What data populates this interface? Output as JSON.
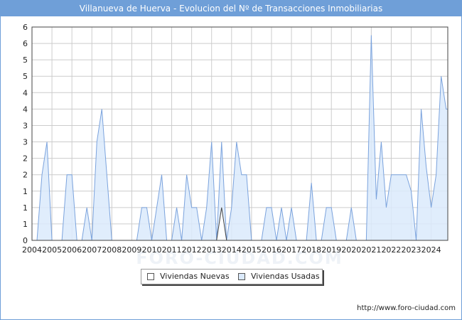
{
  "page": {
    "title": "Villanueva de Huerva - Evolucion del Nº de Transacciones Inmobiliarias",
    "footer_url": "http://www.foro-ciudad.com",
    "watermark": "FORO-CIUDAD.COM"
  },
  "colors": {
    "title_bg": "#6f9fd8",
    "usadas_fill": "#dbeafc",
    "usadas_line": "#7ba3dd",
    "nuevas_fill": "#ffffff",
    "nuevas_line": "#444444",
    "grid": "#cccccc"
  },
  "chart_data": {
    "type": "area",
    "xlim": [
      2004.0,
      2024.833
    ],
    "ylim": [
      0,
      6.5
    ],
    "y_ticks": [
      0,
      0.5,
      1,
      1.5,
      2,
      2.5,
      3,
      3.5,
      4,
      4.5,
      5,
      5.5,
      6,
      6.5
    ],
    "y_tick_labels": [
      "0",
      "1",
      "1",
      "1",
      "2",
      "2",
      "3",
      "3",
      "4",
      "4",
      "5",
      "5",
      "6",
      "6"
    ],
    "x_ticks": [
      2004,
      2005,
      2006,
      2007,
      2008,
      2009,
      2010,
      2011,
      2012,
      2013,
      2014,
      2015,
      2016,
      2017,
      2018,
      2019,
      2020,
      2021,
      2022,
      2023,
      2024
    ],
    "grid": true,
    "legend_position": "bottom-center",
    "series": [
      {
        "name": "Viviendas Nuevas",
        "x": [
          2004.0,
          2013.25,
          2013.5,
          2013.75,
          2024.833
        ],
        "y": [
          0,
          0,
          1,
          0,
          0
        ]
      },
      {
        "name": "Viviendas Usadas",
        "x": [
          2004.0,
          2004.25,
          2004.5,
          2004.75,
          2005.0,
          2005.25,
          2005.5,
          2005.75,
          2006.0,
          2006.25,
          2006.5,
          2006.75,
          2007.0,
          2007.25,
          2007.5,
          2007.75,
          2008.0,
          2008.25,
          2008.5,
          2008.75,
          2009.0,
          2009.25,
          2009.5,
          2009.75,
          2010.0,
          2010.25,
          2010.5,
          2010.75,
          2011.0,
          2011.25,
          2011.5,
          2011.75,
          2012.0,
          2012.25,
          2012.5,
          2012.75,
          2013.0,
          2013.25,
          2013.5,
          2013.75,
          2014.0,
          2014.25,
          2014.5,
          2014.75,
          2015.0,
          2015.25,
          2015.5,
          2015.75,
          2016.0,
          2016.25,
          2016.5,
          2016.75,
          2017.0,
          2017.25,
          2017.5,
          2017.75,
          2018.0,
          2018.25,
          2018.5,
          2018.75,
          2019.0,
          2019.25,
          2019.5,
          2019.75,
          2020.0,
          2020.25,
          2020.5,
          2020.75,
          2021.0,
          2021.25,
          2021.5,
          2021.75,
          2022.0,
          2022.25,
          2022.5,
          2022.75,
          2023.0,
          2023.25,
          2023.5,
          2023.75,
          2024.0,
          2024.25,
          2024.5,
          2024.75,
          2024.833
        ],
        "y": [
          0,
          0,
          2,
          3,
          0,
          0,
          0,
          2,
          2,
          0,
          0,
          1,
          0,
          3,
          4,
          2,
          0,
          0,
          0,
          0,
          0,
          0,
          1,
          1,
          0,
          1,
          2,
          0,
          0,
          1,
          0,
          2,
          1,
          1,
          0,
          1,
          3,
          0,
          3,
          0,
          1,
          3,
          2,
          2,
          0,
          0,
          0,
          1,
          1,
          0,
          1,
          0,
          1,
          0,
          0,
          0,
          1.75,
          0,
          0,
          1,
          1,
          0,
          0,
          0,
          1,
          0,
          0,
          0,
          6.25,
          1.25,
          3,
          1,
          2,
          2,
          2,
          2,
          1.5,
          0,
          4,
          2.25,
          1,
          2,
          5,
          4,
          4
        ]
      }
    ]
  }
}
